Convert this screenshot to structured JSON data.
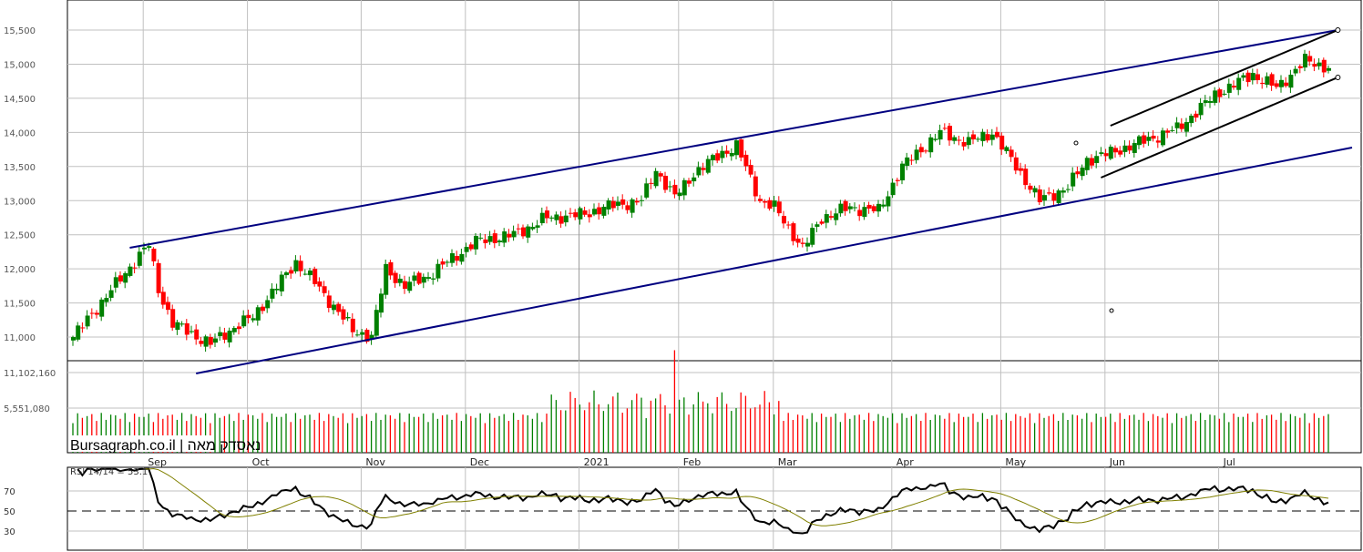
{
  "chart_data": {
    "type": "candlestick",
    "title": "נאסדק מאה",
    "watermark": "Bursagraph.co.il | נאסדק מאה",
    "price_axis": {
      "ticks": [
        "15,500",
        "15,000",
        "14,500",
        "14,000",
        "13,500",
        "13,000",
        "12,500",
        "12,000",
        "11,500",
        "11,000"
      ],
      "values": [
        15500,
        15000,
        14500,
        14000,
        13500,
        13000,
        12500,
        12000,
        11500,
        11000
      ]
    },
    "volume_axis": {
      "ticks": [
        "11,102,160",
        "5,551,080"
      ],
      "values": [
        11102160,
        5551080
      ]
    },
    "rsi": {
      "label": "RSI 14/14 = 53.1",
      "ticks": [
        "70",
        "50",
        "30"
      ],
      "values": [
        70,
        50,
        30
      ]
    },
    "x_labels": [
      {
        "label": "Sep",
        "day": 16
      },
      {
        "label": "Oct",
        "day": 38
      },
      {
        "label": "Nov",
        "day": 62
      },
      {
        "label": "Dec",
        "day": 84
      },
      {
        "label": "2021",
        "day": 108
      },
      {
        "label": "Feb",
        "day": 129
      },
      {
        "label": "Mar",
        "day": 149
      },
      {
        "label": "Apr",
        "day": 174
      },
      {
        "label": "May",
        "day": 197
      },
      {
        "label": "Jun",
        "day": 219
      },
      {
        "label": "Jul",
        "day": 243
      }
    ],
    "close_anchors": [
      [
        0,
        11000
      ],
      [
        14,
        12200
      ],
      [
        16,
        12350
      ],
      [
        18,
        11700
      ],
      [
        21,
        11200
      ],
      [
        29,
        10900
      ],
      [
        33,
        11100
      ],
      [
        38,
        11300
      ],
      [
        47,
        12100
      ],
      [
        51,
        11800
      ],
      [
        59,
        11100
      ],
      [
        63,
        11000
      ],
      [
        66,
        12000
      ],
      [
        70,
        11750
      ],
      [
        75,
        11900
      ],
      [
        81,
        12200
      ],
      [
        85,
        12400
      ],
      [
        93,
        12500
      ],
      [
        100,
        12750
      ],
      [
        108,
        12800
      ],
      [
        112,
        12900
      ],
      [
        120,
        13000
      ],
      [
        123,
        13450
      ],
      [
        127,
        13050
      ],
      [
        131,
        13400
      ],
      [
        137,
        13700
      ],
      [
        140,
        13800
      ],
      [
        145,
        13000
      ],
      [
        148,
        12900
      ],
      [
        154,
        12300
      ],
      [
        158,
        12750
      ],
      [
        164,
        12900
      ],
      [
        170,
        12850
      ],
      [
        175,
        13500
      ],
      [
        183,
        14000
      ],
      [
        189,
        13850
      ],
      [
        194,
        14000
      ],
      [
        198,
        13600
      ],
      [
        204,
        13000
      ],
      [
        210,
        13200
      ],
      [
        214,
        13600
      ],
      [
        219,
        13700
      ],
      [
        225,
        13850
      ],
      [
        233,
        14050
      ],
      [
        241,
        14550
      ],
      [
        249,
        14850
      ],
      [
        254,
        14650
      ],
      [
        260,
        15050
      ],
      [
        265,
        14950
      ]
    ],
    "trendlines": [
      {
        "name": "upper-channel",
        "color": "#000080",
        "from": [
          12,
          12309
        ],
        "to": [
          267,
          15500
        ]
      },
      {
        "name": "lower-channel",
        "color": "#000080",
        "from": [
          26,
          10467
        ],
        "to": [
          270,
          13778
        ]
      },
      {
        "name": "short-upper",
        "color": "#000000",
        "from": [
          219,
          14098
        ],
        "to": [
          267,
          15500
        ]
      },
      {
        "name": "short-lower",
        "color": "#000000",
        "from": [
          217,
          13337
        ],
        "to": [
          267,
          14806
        ]
      }
    ],
    "colors": {
      "up": "#008000",
      "down": "#ff0000",
      "rsi": "#000000",
      "rsi_ma": "#808000",
      "grid": "#c0c0c0"
    }
  }
}
